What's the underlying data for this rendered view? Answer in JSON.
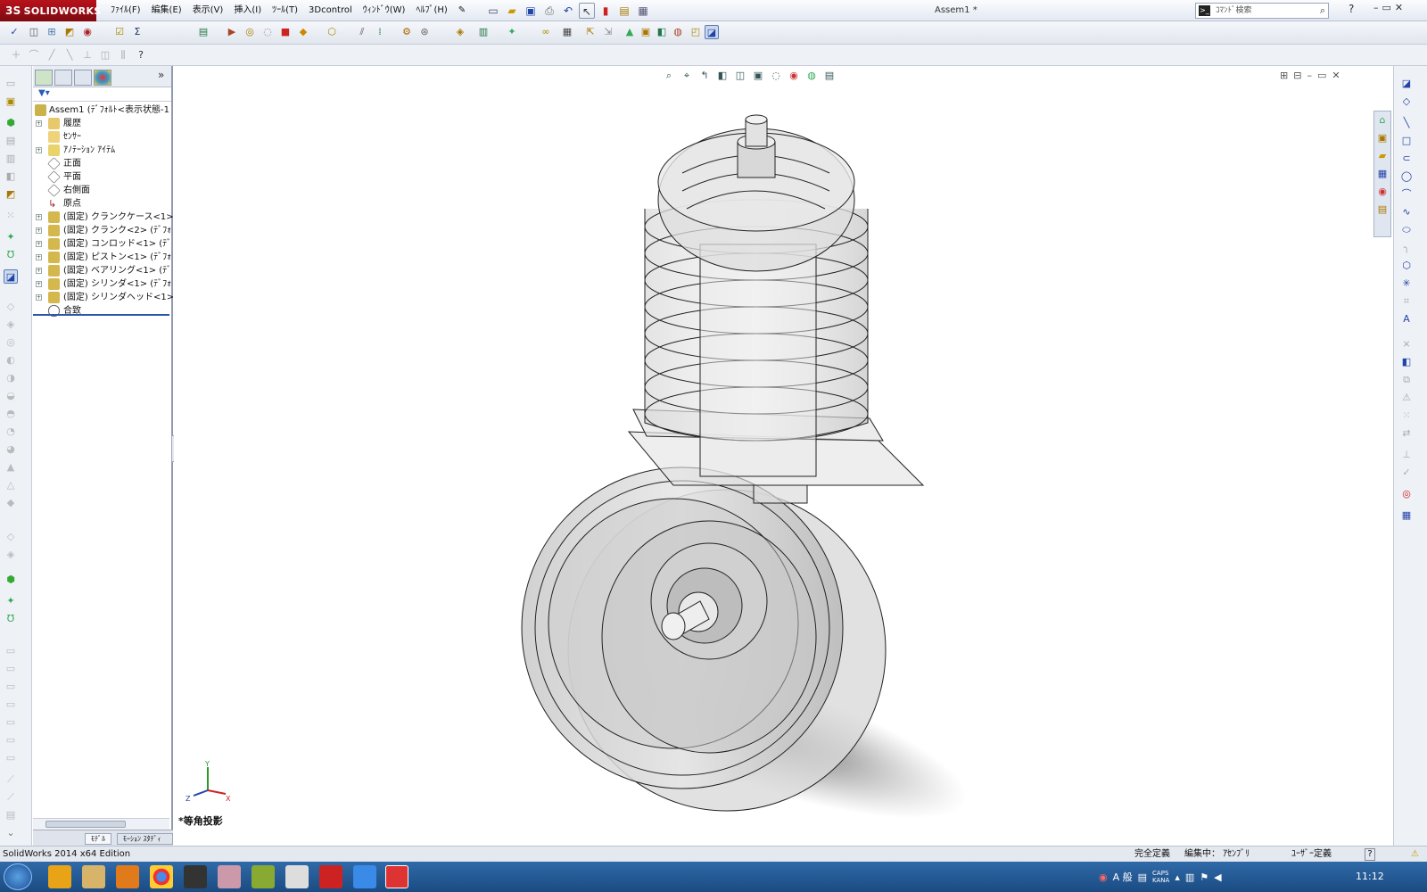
{
  "app": {
    "logo": "SOLIDWORKS",
    "window_title": "Assem1 *"
  },
  "menu": [
    "ﾌｧｲﾙ(F)",
    "編集(E)",
    "表示(V)",
    "挿入(I)",
    "ﾂｰﾙ(T)",
    "3Dcontrol",
    "ｳｨﾝﾄﾞｳ(W)",
    "ﾍﾙﾌﾟ(H)"
  ],
  "search": {
    "placeholder": "ｺﾏﾝﾄﾞ検索"
  },
  "tree": {
    "root": "Assem1 (ﾃﾞﾌｫﾙﾄ<表示状態-1",
    "items": [
      "履歴",
      "ｾﾝｻｰ",
      "ｱﾉﾃｰｼｮﾝ ｱｲﾃﾑ",
      "正面",
      "平面",
      "右側面",
      "原点",
      "(固定) クランクケース<1>",
      "(固定) クランク<2> (ﾃﾞﾌｫ",
      "(固定) コンロッド<1> (ﾃﾞ",
      "(固定) ピストン<1> (ﾃﾞﾌｫ",
      "(固定) ベアリング<1> (ﾃﾞ",
      "(固定) シリンダ<1> (ﾃﾞﾌｫ",
      "(固定) シリンダヘッド<1>",
      "合致"
    ]
  },
  "bottom_tabs": {
    "model": "ﾓﾃﾞﾙ",
    "motion": "ﾓｰｼｮﾝ ｽﾀﾃﾞｨ 1"
  },
  "viewport": {
    "projection": "*等角投影",
    "triad": {
      "x": "X",
      "y": "Y",
      "z": "Z"
    }
  },
  "status": {
    "edition": "SolidWorks 2014 x64 Edition",
    "defined": "完全定義",
    "editing": "編集中： ｱｾﾝﾌﾞﾘ",
    "units": "ﾕｰｻﾞｰ定義",
    "help": "?"
  },
  "taskbar": {
    "time": "11:12",
    "ime": "A 般",
    "caps": "CAPS",
    "kana": "KANA"
  }
}
